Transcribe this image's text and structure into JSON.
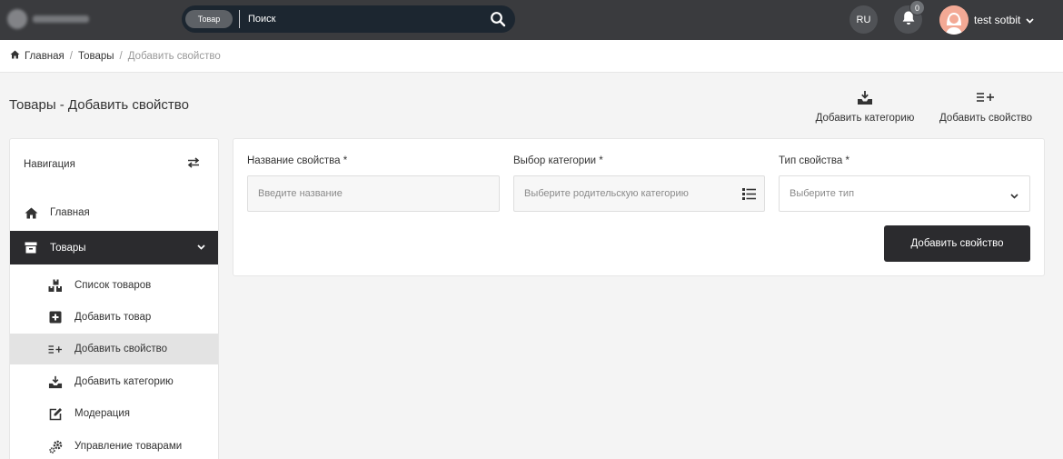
{
  "topbar": {
    "search_category": "Товар",
    "search_placeholder": "Поиск",
    "language": "RU",
    "notifications_count": "0",
    "user_name": "test sotbit"
  },
  "breadcrumb": {
    "home": "Главная",
    "divider": "/",
    "section": "Товары",
    "current": "Добавить свойство"
  },
  "page": {
    "title": "Товары - Добавить свойство",
    "action_add_category": "Добавить категорию",
    "action_add_property": "Добавить свойство"
  },
  "sidebar": {
    "heading": "Навигация",
    "home": "Главная",
    "section": "Товары",
    "items": [
      {
        "label": "Список товаров",
        "icon": "boxes-icon"
      },
      {
        "label": "Добавить товар",
        "icon": "plus-square-icon"
      },
      {
        "label": "Добавить свойство",
        "icon": "list-plus-icon",
        "selected": true
      },
      {
        "label": "Добавить категорию",
        "icon": "tray-download-icon"
      },
      {
        "label": "Модерация",
        "icon": "edit-icon"
      },
      {
        "label": "Управление товарами",
        "icon": "cogs-icon"
      }
    ]
  },
  "form": {
    "name_label": "Название свойства *",
    "name_placeholder": "Введите название",
    "category_label": "Выбор категории *",
    "category_placeholder": "Выберите родительскую категорию",
    "type_label": "Тип свойства *",
    "type_placeholder": "Выберите тип",
    "submit_label": "Добавить свойство"
  },
  "colors": {
    "topbar": "#3a3b3e",
    "search_bg": "#1c2630",
    "dark_accent": "#2b2b2e",
    "selected_bg": "#e3e3e3"
  }
}
